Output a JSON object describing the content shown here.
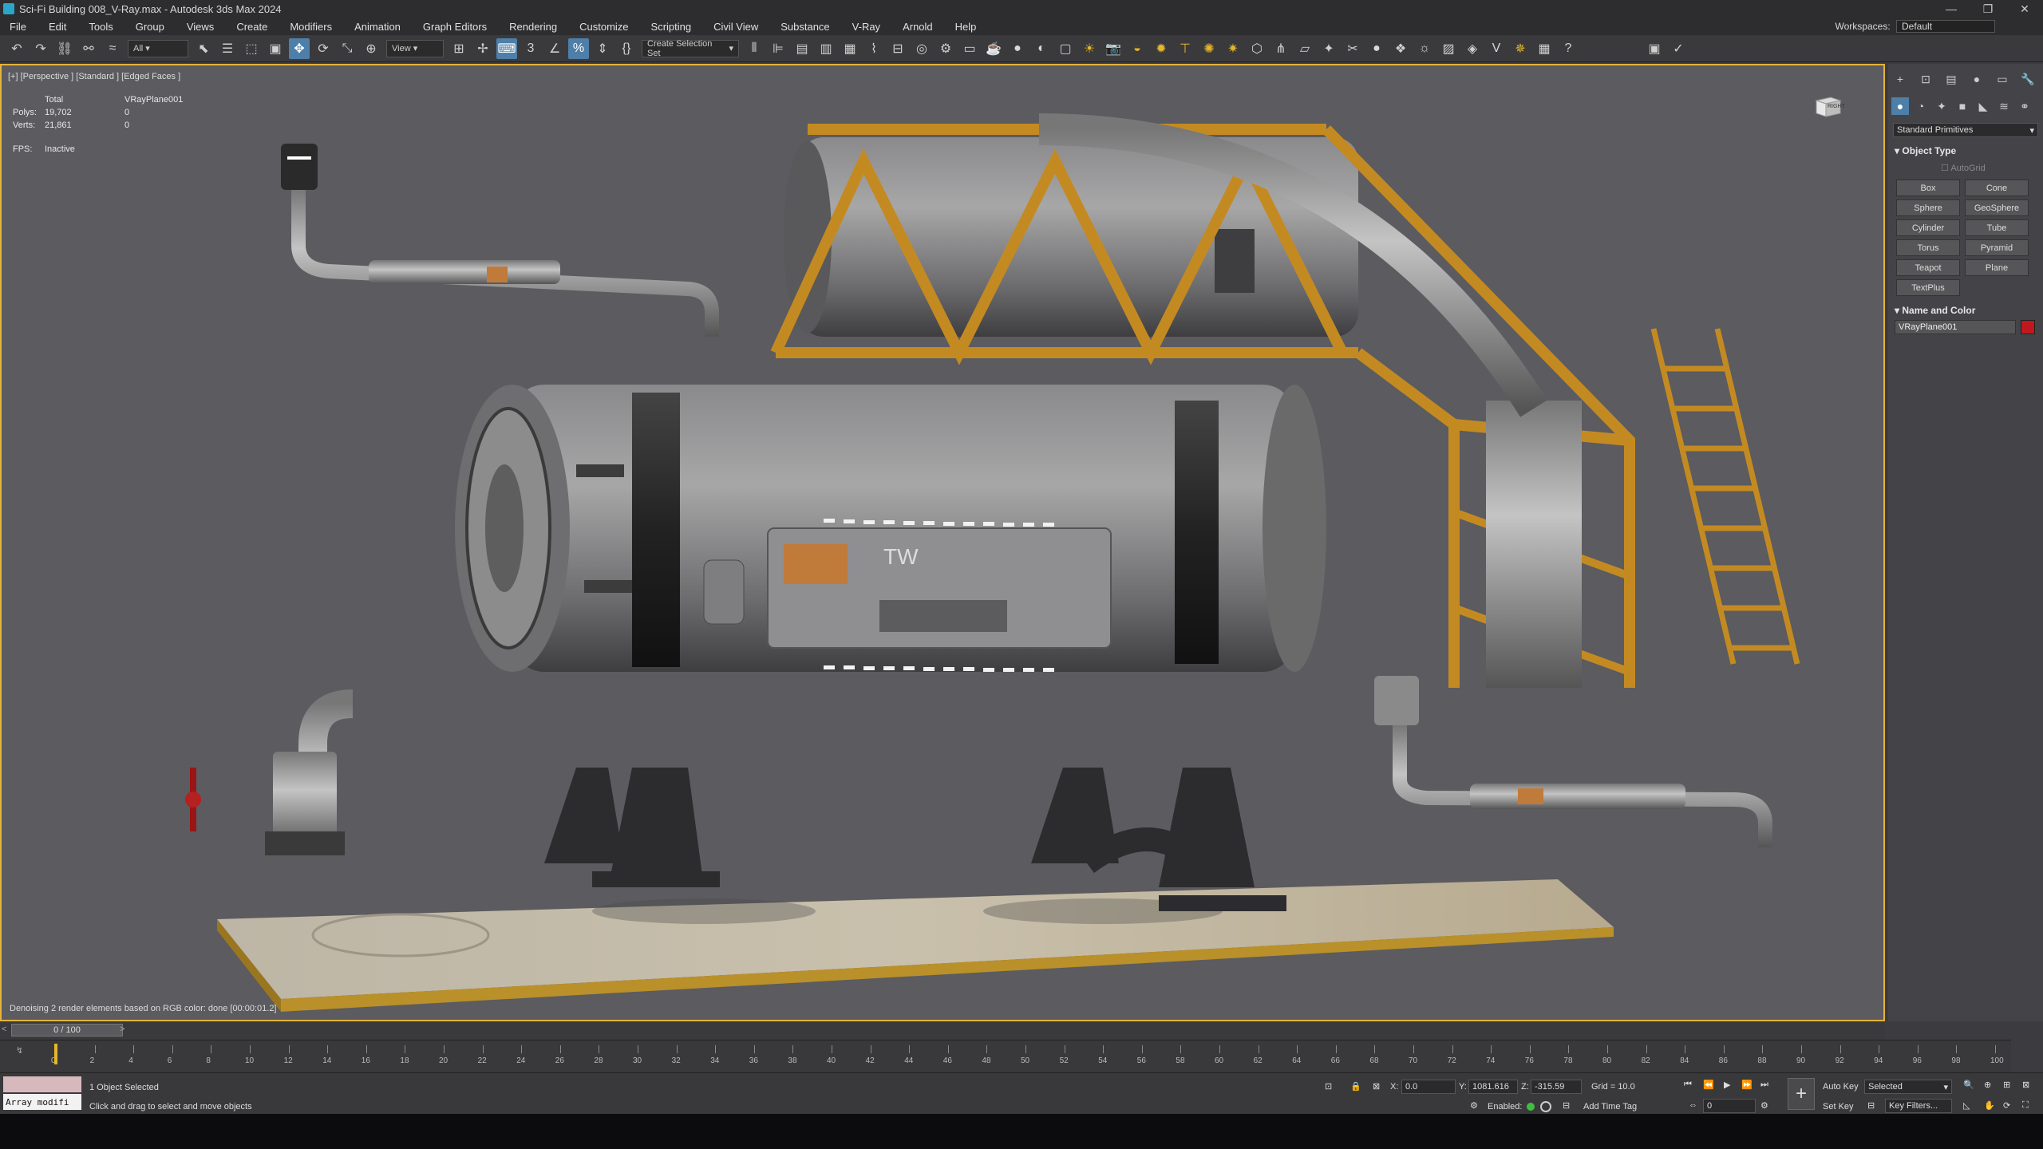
{
  "window": {
    "title": "Sci-Fi Building 008_V-Ray.max - Autodesk 3ds Max 2024",
    "controls": [
      "—",
      "❐",
      "✕"
    ]
  },
  "menu": {
    "items": [
      "File",
      "Edit",
      "Tools",
      "Group",
      "Views",
      "Create",
      "Modifiers",
      "Animation",
      "Graph Editors",
      "Rendering",
      "Customize",
      "Scripting",
      "Civil View",
      "Substance",
      "V-Ray",
      "Arnold",
      "Help"
    ],
    "workspaces_label": "Workspaces:",
    "workspace_value": "Default"
  },
  "toolbar": {
    "filter_value": "All",
    "ref_coord_value": "View",
    "selection_set_value": "Create Selection Set"
  },
  "viewport": {
    "label": "[+] [Perspective ] [Standard ] [Edged Faces ]",
    "stats": {
      "col_headers": [
        "",
        "Total",
        "VRayPlane001"
      ],
      "rows": [
        {
          "label": "Polys:",
          "total": "19,702",
          "sel": "0"
        },
        {
          "label": "Verts:",
          "total": "21,861",
          "sel": "0"
        }
      ],
      "fps_label": "FPS:",
      "fps_value": "Inactive"
    },
    "denoise_message": "Denoising 2 render elements based on RGB color: done [00:00:01.2]",
    "viewcube_label": "RIGHT",
    "panel_text": "TW"
  },
  "command_panel": {
    "category_dropdown": "Standard Primitives",
    "object_type_title": "Object Type",
    "autogrid_label": "AutoGrid",
    "primitives": [
      "Box",
      "Cone",
      "Sphere",
      "GeoSphere",
      "Cylinder",
      "Tube",
      "Torus",
      "Pyramid",
      "Teapot",
      "Plane",
      "TextPlus"
    ],
    "name_color_title": "Name and Color",
    "object_name": "VRayPlane001",
    "object_color": "#c0181e"
  },
  "timeline": {
    "frame_display": "0 / 100",
    "ticks": [
      "0",
      "2",
      "4",
      "6",
      "8",
      "10",
      "12",
      "14",
      "16",
      "18",
      "20",
      "22",
      "24",
      "26",
      "28",
      "30",
      "32",
      "34",
      "36",
      "38",
      "40",
      "42",
      "44",
      "46",
      "48",
      "50",
      "52",
      "54",
      "56",
      "58",
      "60",
      "62",
      "64",
      "66",
      "68",
      "70",
      "72",
      "74",
      "76",
      "78",
      "80",
      "82",
      "84",
      "86",
      "88",
      "90",
      "92",
      "94",
      "96",
      "98",
      "100"
    ]
  },
  "status": {
    "maxscript_label": "Array modifi",
    "selection_info": "1 Object Selected",
    "prompt": "Click and drag to select and move objects",
    "x_label": "X:",
    "x_value": "0.0",
    "y_label": "Y:",
    "y_value": "1081.616",
    "z_label": "Z:",
    "z_value": "-315.59",
    "grid": "Grid = 10.0",
    "enabled_label": "Enabled:",
    "add_time_tag": "Add Time Tag",
    "auto_key": "Auto Key",
    "set_key": "Set Key",
    "key_mode_value": "Selected",
    "key_filters": "Key Filters...",
    "frame_field": "0"
  }
}
